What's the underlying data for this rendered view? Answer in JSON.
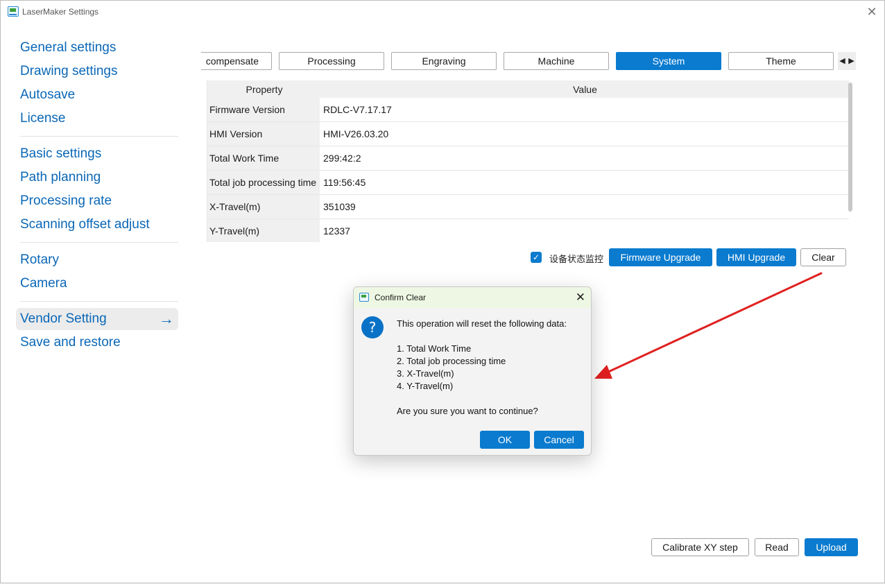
{
  "window": {
    "title": "LaserMaker Settings"
  },
  "sidebar": {
    "groups": [
      [
        "General settings",
        "Drawing settings",
        "Autosave",
        "License"
      ],
      [
        "Basic settings",
        "Path planning",
        "Processing rate",
        "Scanning offset adjust"
      ],
      [
        "Rotary",
        "Camera"
      ],
      [
        "Vendor Setting",
        "Save and restore"
      ]
    ],
    "active": "Vendor Setting"
  },
  "tabs": {
    "items": [
      "compensate",
      "Processing",
      "Engraving",
      "Machine",
      "System",
      "Theme"
    ],
    "active": "System",
    "scroll_left": "◀",
    "scroll_right": "▶"
  },
  "table": {
    "headers": {
      "property": "Property",
      "value": "Value"
    },
    "rows": [
      {
        "property": "Firmware Version",
        "value": "RDLC-V7.17.17"
      },
      {
        "property": "HMI Version",
        "value": "HMI-V26.03.20"
      },
      {
        "property": "Total Work Time",
        "value": "299:42:2"
      },
      {
        "property": "Total job processing time",
        "value": "119:56:45"
      },
      {
        "property": "X-Travel(m)",
        "value": "351039"
      },
      {
        "property": "Y-Travel(m)",
        "value": "12337"
      }
    ]
  },
  "actions": {
    "monitor_label": "设备状态监控",
    "monitor_checked": true,
    "firmware_upgrade": "Firmware Upgrade",
    "hmi_upgrade": "HMI Upgrade",
    "clear": "Clear"
  },
  "footer": {
    "calibrate": "Calibrate XY step",
    "read": "Read",
    "upload": "Upload"
  },
  "dialog": {
    "title": "Confirm Clear",
    "icon": "question-icon",
    "intro": "This operation will reset the following data:",
    "items": [
      "1. Total Work Time",
      "2. Total job processing time",
      "3. X-Travel(m)",
      "4. Y-Travel(m)"
    ],
    "question": "Are you sure you want to continue?",
    "ok": "OK",
    "cancel": "Cancel"
  },
  "colors": {
    "accent": "#0a7bcf",
    "link": "#0a67b7",
    "annotation_arrow": "#e02020"
  }
}
